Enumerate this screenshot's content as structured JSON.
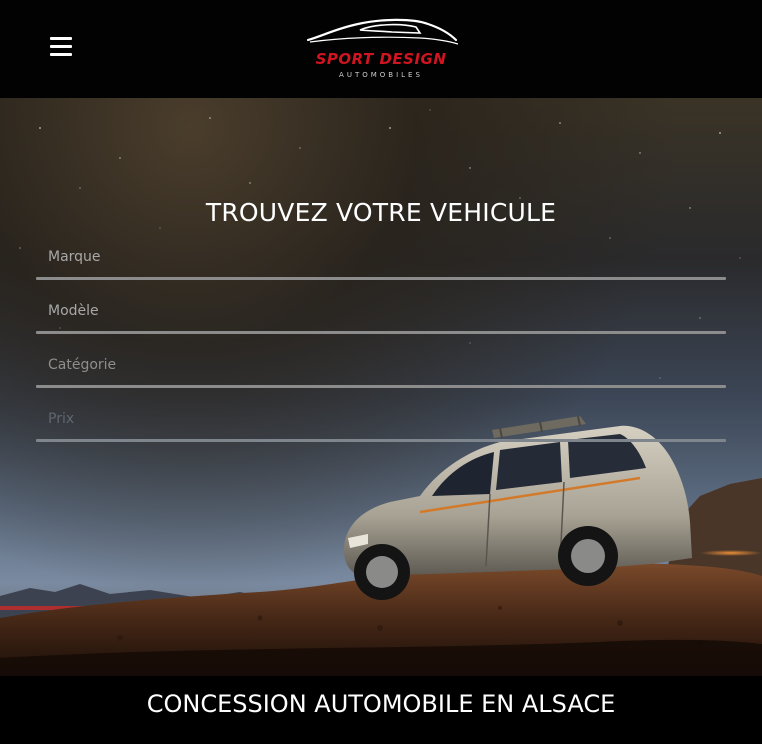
{
  "header": {
    "menu_icon": "hamburger-menu-icon",
    "logo": {
      "title": "SPORT DESIGN",
      "subtitle": "AUTOMOBILES",
      "title_color": "#d01420"
    }
  },
  "search": {
    "title": "TROUVEZ VOTRE VEHICULE",
    "fields": [
      {
        "placeholder": "Marque"
      },
      {
        "placeholder": "Modèle"
      },
      {
        "placeholder": "Catégorie"
      },
      {
        "placeholder": "Prix"
      }
    ]
  },
  "footer": {
    "title": "CONCESSION AUTOMOBILE EN ALSACE"
  },
  "colors": {
    "header_bg": "#020202",
    "brand_red": "#d01420",
    "text_white": "#ffffff",
    "field_line": "#8c8c8c"
  }
}
